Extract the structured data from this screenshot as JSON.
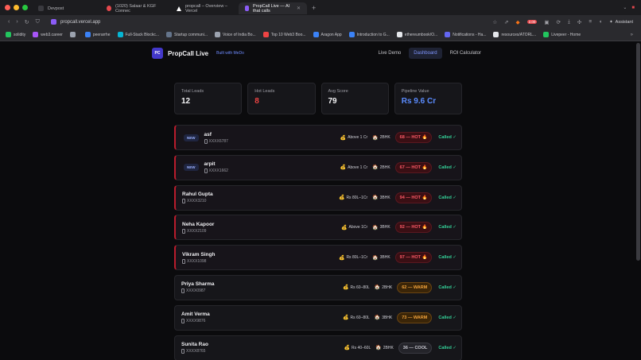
{
  "browser": {
    "traffic_colors": [
      "#ff5f57",
      "#febc2e",
      "#28c840"
    ],
    "tabs": [
      {
        "label": "Devpost",
        "color": "#3a3a3f",
        "active": false
      },
      {
        "label": "(1020) Salaar & KGF Connec",
        "color": "#e5484d",
        "active": false
      },
      {
        "label": "propcall – Overview – Vercel",
        "color": "#ffffff",
        "active": false
      },
      {
        "label": "PropCall Live — AI that calls",
        "color": "#8b5cf6",
        "active": true
      }
    ],
    "new_tab": "+",
    "url": "propcall.vercel.app",
    "ext_badge": "2.00",
    "assistant_label": "Assistant",
    "bookmarks": [
      {
        "label": "solidity",
        "color": "#22c55e"
      },
      {
        "label": "web3.career",
        "color": "#a855f7"
      },
      {
        "label": "",
        "color": "#9ca3af"
      },
      {
        "label": "peerarrhe",
        "color": "#3b82f6"
      },
      {
        "label": "Full-Stack Blockc...",
        "color": "#06b6d4"
      },
      {
        "label": "Startup communi...",
        "color": "#64748b"
      },
      {
        "label": "Voice of India Bo...",
        "color": "#9ca3af"
      },
      {
        "label": "Top 10 Web3 Boo...",
        "color": "#ef4444"
      },
      {
        "label": "Aragon App",
        "color": "#3b82f6"
      },
      {
        "label": "Introduction to G...",
        "color": "#3b82f6"
      },
      {
        "label": "ethereumbook/O...",
        "color": "#e5e7eb"
      },
      {
        "label": "Notifications - Ha...",
        "color": "#6366f1"
      },
      {
        "label": "resources/ATORL...",
        "color": "#e5e7eb"
      },
      {
        "label": "Livepeer - Home",
        "color": "#22c55e"
      }
    ],
    "bookmarks_more": "»"
  },
  "app": {
    "logo_text": "PC",
    "brand": "PropCall Live",
    "built_with": "Built with MeDo",
    "nav": [
      {
        "label": "Live Demo",
        "active": false
      },
      {
        "label": "Dashboard",
        "active": true
      },
      {
        "label": "ROI Calculator",
        "active": false
      }
    ]
  },
  "stats": [
    {
      "label": "Total Leads",
      "value": "12",
      "tone": "plain"
    },
    {
      "label": "Hot Leads",
      "value": "8",
      "tone": "red"
    },
    {
      "label": "Avg Score",
      "value": "79",
      "tone": "plain"
    },
    {
      "label": "Pipeline Value",
      "value": "Rs 9.6 Cr",
      "tone": "blue"
    }
  ],
  "leads": [
    {
      "name": "asf",
      "phone": "XXXX6787",
      "is_new": true,
      "hot_border": true,
      "budget": "Above 1 Cr",
      "bhk": "2BHK",
      "score": "68 — HOT 🔥",
      "tier": "hot",
      "status": "Called ✓"
    },
    {
      "name": "arpit",
      "phone": "XXXX1662",
      "is_new": true,
      "hot_border": true,
      "budget": "Above 1 Cr",
      "bhk": "2BHK",
      "score": "67 — HOT 🔥",
      "tier": "hot",
      "status": "Called ✓"
    },
    {
      "name": "Rahul Gupta",
      "phone": "XXXX3210",
      "is_new": false,
      "hot_border": true,
      "budget": "Rs 80L–1Cr",
      "bhk": "3BHK",
      "score": "94 — HOT 🔥",
      "tier": "hot",
      "status": "Called ✓"
    },
    {
      "name": "Neha Kapoor",
      "phone": "XXXX2109",
      "is_new": false,
      "hot_border": true,
      "budget": "Above 1Cr",
      "bhk": "3BHK",
      "score": "92 — HOT 🔥",
      "tier": "hot",
      "status": "Called ✓"
    },
    {
      "name": "Vikram Singh",
      "phone": "XXXX1098",
      "is_new": false,
      "hot_border": true,
      "budget": "Rs 80L–1Cr",
      "bhk": "3BHK",
      "score": "97 — HOT 🔥",
      "tier": "hot",
      "status": "Called ✓"
    },
    {
      "name": "Priya Sharma",
      "phone": "XXXX0987",
      "is_new": false,
      "hot_border": false,
      "budget": "Rs 60–80L",
      "bhk": "2BHK",
      "score": "62 — WARM",
      "tier": "warm",
      "status": "Called ✓"
    },
    {
      "name": "Amit Verma",
      "phone": "XXXX9876",
      "is_new": false,
      "hot_border": false,
      "budget": "Rs 60–80L",
      "bhk": "3BHK",
      "score": "73 — WARM",
      "tier": "warm",
      "status": "Called ✓"
    },
    {
      "name": "Sunita Rao",
      "phone": "XXXX8765",
      "is_new": false,
      "hot_border": false,
      "budget": "Rs 40–60L",
      "bhk": "2BHK",
      "score": "36 — COOL",
      "tier": "cool",
      "status": "Called ✓"
    }
  ],
  "icons": {
    "budget": "money-bag-icon",
    "bhk": "house-icon",
    "phone": "phone-icon"
  }
}
